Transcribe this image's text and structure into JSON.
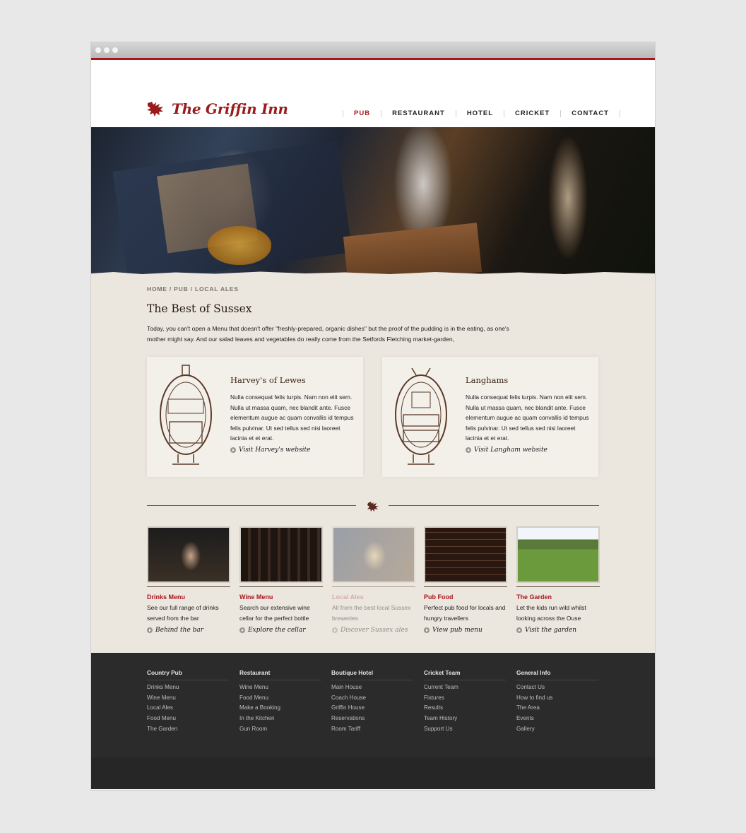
{
  "site": {
    "name": "The Griffin Inn"
  },
  "nav": {
    "items": [
      "PUB",
      "RESTAURANT",
      "HOTEL",
      "CRICKET",
      "CONTACT"
    ]
  },
  "breadcrumb": "HOME / PUB / LOCAL ALES",
  "page": {
    "title": "The Best of Sussex",
    "intro": "Today, you can't open a Menu that doesn't offer \"freshly-prepared, organic dishes\" but the proof of the pudding is in the eating, as one's mother might say. And our salad leaves and vegetables do really come from the Setfords Fletching market-garden,"
  },
  "ales": [
    {
      "title": "Harvey's of Lewes",
      "desc": "Nulla consequat felis turpis. Nam non elit sem. Nulla ut massa quam, nec blandit ante. Fusce elementum augue ac quam convallis id tempus felis pulvinar. Ut sed tellus sed nisi laoreet lacinia et et erat.",
      "link": "Visit Harvey's website"
    },
    {
      "title": "Langhams",
      "desc": "Nulla consequat felis turpis. Nam non elit sem. Nulla ut massa quam, nec blandit ante. Fusce elementum augue ac quam convallis id tempus felis pulvinar. Ut sed tellus sed nisi laoreet lacinia et et erat.",
      "link": "Visit Langham website"
    }
  ],
  "features": [
    {
      "title": "Drinks Menu",
      "desc": "See our full range of drinks served from the bar",
      "link": "Behind the bar"
    },
    {
      "title": "Wine Menu",
      "desc": "Search our extensive wine cellar for the perfect bottle",
      "link": "Explore the cellar"
    },
    {
      "title": "Local Ales",
      "desc": "All from the best local Sussex breweries",
      "link": "Discover Sussex ales"
    },
    {
      "title": "Pub Food",
      "desc": "Perfect pub food for locals and hungry travellers",
      "link": "View pub menu"
    },
    {
      "title": "The Garden",
      "desc": "Let the kids run wild whilst looking across the Ouse",
      "link": "Visit the garden"
    }
  ],
  "footer": [
    {
      "heading": "Country Pub",
      "links": [
        "Drinks Menu",
        "Wine Menu",
        "Local Ales",
        "Food Menu",
        "The Garden"
      ]
    },
    {
      "heading": "Restaurant",
      "links": [
        "Wine Menu",
        "Food Menu",
        "Make a Booking",
        "In the Kitchen",
        "Gun Room"
      ]
    },
    {
      "heading": "Boutique Hotel",
      "links": [
        "Main House",
        "Coach House",
        "Griffin House",
        "Reservations",
        "Room Tariff"
      ]
    },
    {
      "heading": "Cricket Team",
      "links": [
        "Current Team",
        "Fixtures",
        "Results",
        "Team History",
        "Support Us"
      ]
    },
    {
      "heading": "General Info",
      "links": [
        "Contact Us",
        "How to find us",
        "The Area",
        "Events",
        "Gallery"
      ]
    }
  ],
  "colors": {
    "brand_red": "#a8161c",
    "paper": "#ebe6de",
    "footer_bg": "#2b2b2b"
  }
}
